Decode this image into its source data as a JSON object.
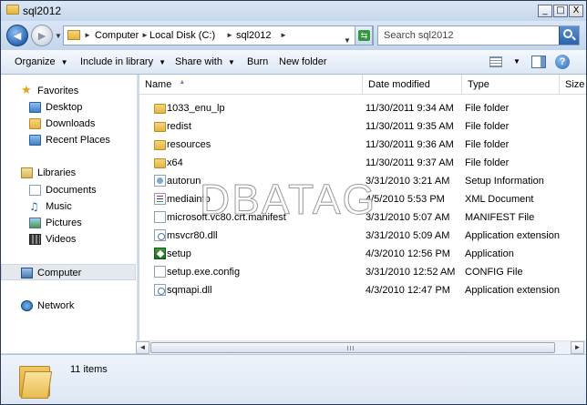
{
  "window": {
    "title": "sql2012",
    "minimize_glyph": "_",
    "maximize_glyph": "□",
    "close_glyph": "X"
  },
  "address": {
    "crumbs": [
      "Computer",
      "Local Disk (C:)",
      "sql2012"
    ],
    "back_glyph": "◄",
    "forward_glyph": "►"
  },
  "search": {
    "placeholder": "Search sql2012"
  },
  "toolbar": {
    "organize": "Organize",
    "include_in_library": "Include in library",
    "share_with": "Share with",
    "burn": "Burn",
    "new_folder": "New folder",
    "help_glyph": "?"
  },
  "nav": {
    "favorites": "Favorites",
    "desktop": "Desktop",
    "downloads": "Downloads",
    "recent_places": "Recent Places",
    "libraries": "Libraries",
    "documents": "Documents",
    "music": "Music",
    "pictures": "Pictures",
    "videos": "Videos",
    "computer": "Computer",
    "network": "Network"
  },
  "columns": {
    "name": "Name",
    "date_modified": "Date modified",
    "type": "Type",
    "size": "Size"
  },
  "files": [
    {
      "name": "1033_enu_lp",
      "date": "11/30/2011 9:34 AM",
      "type": "File folder",
      "icon": "folder"
    },
    {
      "name": "redist",
      "date": "11/30/2011 9:35 AM",
      "type": "File folder",
      "icon": "folder"
    },
    {
      "name": "resources",
      "date": "11/30/2011 9:36 AM",
      "type": "File folder",
      "icon": "folder"
    },
    {
      "name": "x64",
      "date": "11/30/2011 9:37 AM",
      "type": "File folder",
      "icon": "folder"
    },
    {
      "name": "autorun",
      "date": "3/31/2010 3:21 AM",
      "type": "Setup Information",
      "icon": "setup-info"
    },
    {
      "name": "mediainfo",
      "date": "4/5/2010 5:53 PM",
      "type": "XML Document",
      "icon": "xml"
    },
    {
      "name": "microsoft.vc80.crt.manifest",
      "date": "3/31/2010 5:07 AM",
      "type": "MANIFEST File",
      "icon": "generic"
    },
    {
      "name": "msvcr80.dll",
      "date": "3/31/2010 5:09 AM",
      "type": "Application extension",
      "icon": "dll"
    },
    {
      "name": "setup",
      "date": "4/3/2010 12:56 PM",
      "type": "Application",
      "icon": "exe"
    },
    {
      "name": "setup.exe.config",
      "date": "3/31/2010 12:52 AM",
      "type": "CONFIG File",
      "icon": "generic"
    },
    {
      "name": "sqmapi.dll",
      "date": "4/3/2010 12:47 PM",
      "type": "Application extension",
      "icon": "dll"
    }
  ],
  "watermark": "DBATAG",
  "status": {
    "item_count": "11 items"
  }
}
